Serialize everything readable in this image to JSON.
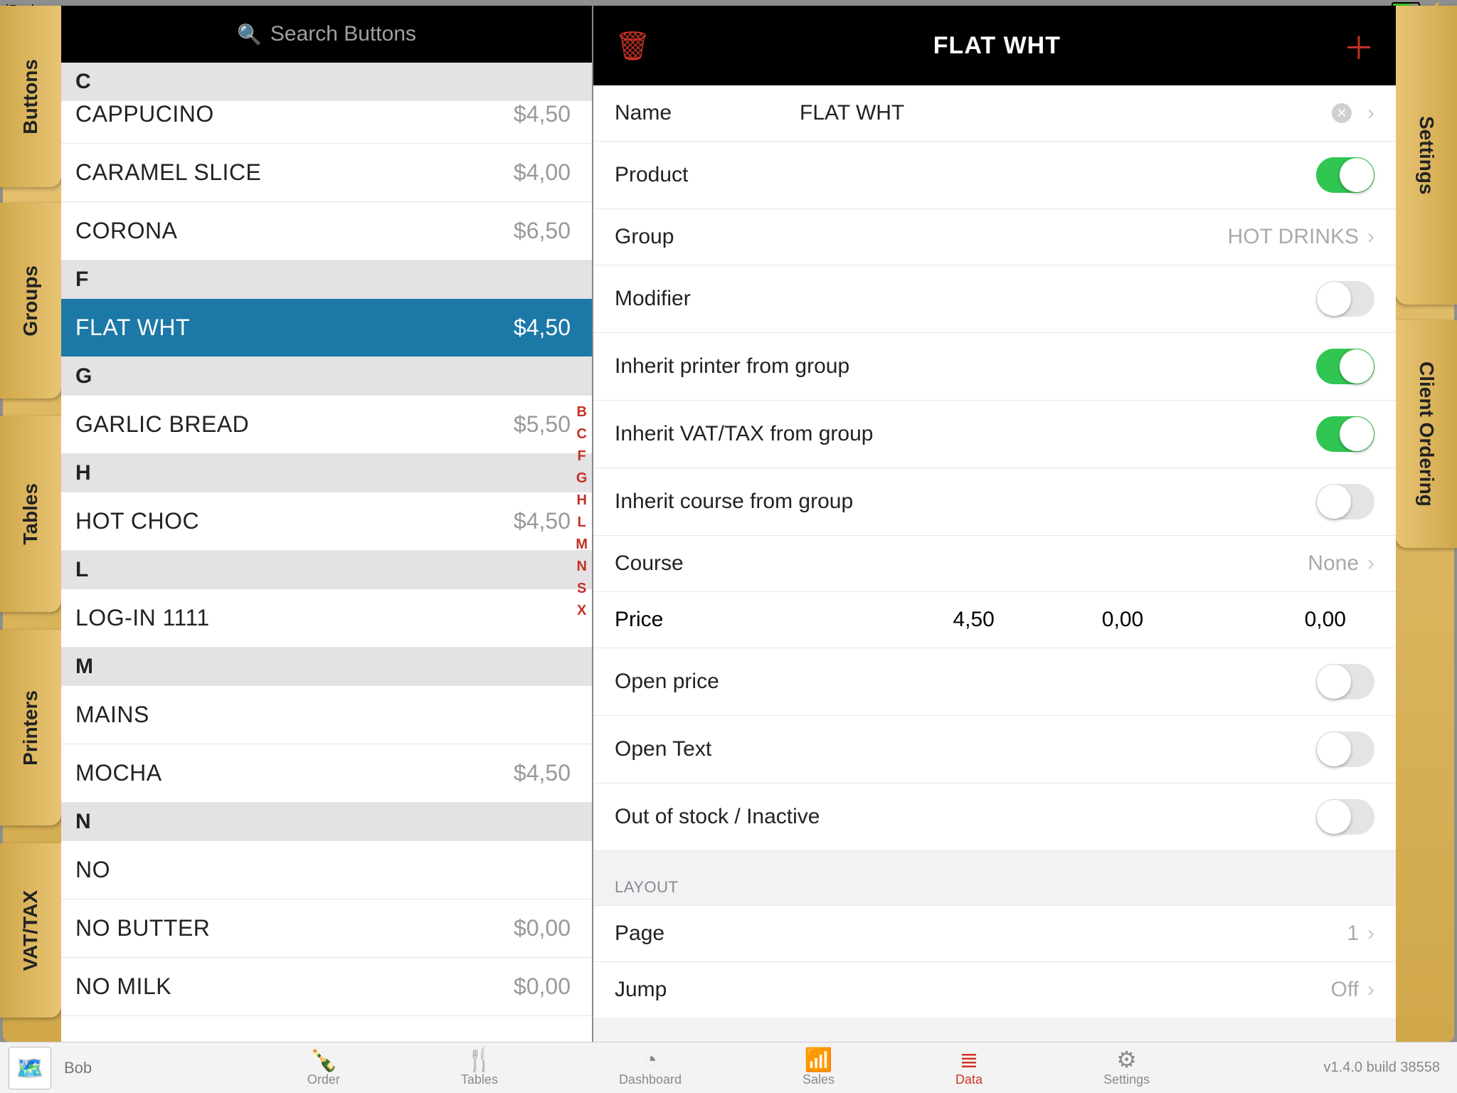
{
  "status": {
    "device": "iPad",
    "wifi": "ᯤ",
    "charging": true
  },
  "left_tabs": [
    "Buttons",
    "Groups",
    "Tables",
    "Printers",
    "VAT/TAX"
  ],
  "right_tabs": [
    "Settings",
    "Client Ordering"
  ],
  "search": {
    "placeholder": "Search Buttons"
  },
  "list": {
    "sections": [
      {
        "letter": "C",
        "items": [
          {
            "name": "CAPPUCINO",
            "price": "$4,50",
            "cut_top": true
          },
          {
            "name": "CARAMEL SLICE",
            "price": "$4,00"
          },
          {
            "name": "CORONA",
            "price": "$6,50"
          }
        ]
      },
      {
        "letter": "F",
        "items": [
          {
            "name": "FLAT WHT",
            "price": "$4,50",
            "selected": true
          }
        ]
      },
      {
        "letter": "G",
        "items": [
          {
            "name": "GARLIC BREAD",
            "price": "$5,50"
          }
        ]
      },
      {
        "letter": "H",
        "items": [
          {
            "name": "HOT CHOC",
            "price": "$4,50"
          }
        ]
      },
      {
        "letter": "L",
        "items": [
          {
            "name": "LOG-IN 1111",
            "price": ""
          }
        ]
      },
      {
        "letter": "M",
        "items": [
          {
            "name": "MAINS",
            "price": ""
          },
          {
            "name": "MOCHA",
            "price": "$4,50"
          }
        ]
      },
      {
        "letter": "N",
        "items": [
          {
            "name": "NO",
            "price": ""
          },
          {
            "name": "NO BUTTER",
            "price": "$0,00"
          },
          {
            "name": "NO MILK",
            "price": "$0,00",
            "cut_bottom": true
          }
        ]
      }
    ],
    "index_letters": [
      "B",
      "C",
      "F",
      "G",
      "H",
      "L",
      "M",
      "N",
      "S",
      "X"
    ]
  },
  "detail": {
    "title": "FLAT WHT",
    "fields": {
      "name_label": "Name",
      "name_value": "FLAT WHT",
      "product_label": "Product",
      "product_on": true,
      "group_label": "Group",
      "group_value": "HOT DRINKS",
      "modifier_label": "Modifier",
      "modifier_on": false,
      "inherit_printer_label": "Inherit printer from group",
      "inherit_printer_on": true,
      "inherit_vat_label": "Inherit VAT/TAX from group",
      "inherit_vat_on": true,
      "inherit_course_label": "Inherit course from group",
      "inherit_course_on": false,
      "course_label": "Course",
      "course_value": "None",
      "price_label": "Price",
      "price_1": "4,50",
      "price_2": "0,00",
      "price_3": "0,00",
      "open_price_label": "Open price",
      "open_price_on": false,
      "open_text_label": "Open Text",
      "open_text_on": false,
      "oos_label": "Out of stock / Inactive",
      "oos_on": false,
      "layout_header": "LAYOUT",
      "page_label": "Page",
      "page_value": "1",
      "jump_label": "Jump",
      "jump_value": "Off"
    }
  },
  "bottom": {
    "user": "Bob",
    "items": [
      {
        "id": "order",
        "label": "Order",
        "icon": "🍾"
      },
      {
        "id": "tables",
        "label": "Tables",
        "icon": "🍴"
      },
      {
        "id": "dashboard",
        "label": "Dashboard",
        "icon": "◔"
      },
      {
        "id": "sales",
        "label": "Sales",
        "icon": "📶"
      },
      {
        "id": "data",
        "label": "Data",
        "icon": "≣",
        "active": true
      },
      {
        "id": "settings",
        "label": "Settings",
        "icon": "⚙"
      }
    ],
    "version": "v1.4.0 build 38558"
  }
}
